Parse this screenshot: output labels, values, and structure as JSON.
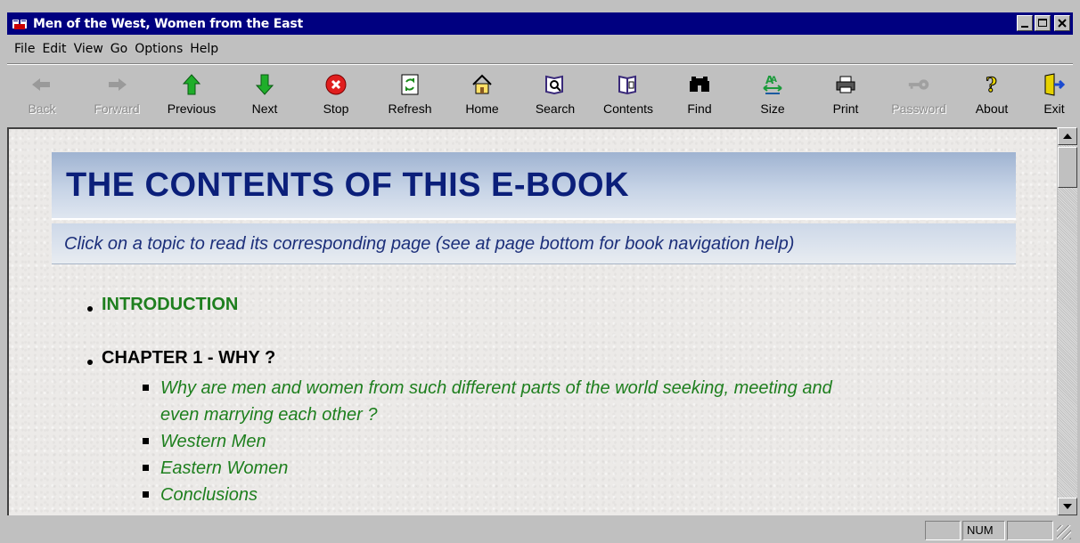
{
  "window": {
    "title": "Men of the West, Women from the East"
  },
  "menu": [
    {
      "label": "File"
    },
    {
      "label": "Edit"
    },
    {
      "label": "View"
    },
    {
      "label": "Go"
    },
    {
      "label": "Options"
    },
    {
      "label": "Help"
    }
  ],
  "toolbar": [
    {
      "label": "Back",
      "icon": "back-arrow-icon",
      "enabled": false
    },
    {
      "label": "Forward",
      "icon": "forward-arrow-icon",
      "enabled": false
    },
    {
      "label": "Previous",
      "icon": "up-arrow-icon",
      "enabled": true
    },
    {
      "label": "Next",
      "icon": "down-arrow-icon",
      "enabled": true
    },
    {
      "label": "Stop",
      "icon": "stop-icon",
      "enabled": true
    },
    {
      "label": "Refresh",
      "icon": "refresh-icon",
      "enabled": true
    },
    {
      "label": "Home",
      "icon": "home-icon",
      "enabled": true
    },
    {
      "label": "Search",
      "icon": "search-icon",
      "enabled": true
    },
    {
      "label": "Contents",
      "icon": "contents-icon",
      "enabled": true
    },
    {
      "label": "Find",
      "icon": "binoculars-icon",
      "enabled": true
    },
    {
      "label": "Size",
      "icon": "font-size-icon",
      "enabled": true
    },
    {
      "label": "Print",
      "icon": "printer-icon",
      "enabled": true
    },
    {
      "label": "Password",
      "icon": "key-icon",
      "enabled": false
    },
    {
      "label": "About",
      "icon": "question-icon",
      "enabled": true
    },
    {
      "label": "Exit",
      "icon": "exit-door-icon",
      "enabled": true
    }
  ],
  "page": {
    "heading": "THE CONTENTS OF THIS E-BOOK",
    "subheading": "Click on a topic to read its corresponding page (see at page bottom for book navigation help)",
    "toc": {
      "introduction": "INTRODUCTION",
      "chapter1": "CHAPTER 1 - WHY ?",
      "chapter1_items": [
        "Why are men and women from such different parts of the world seeking, meeting and",
        "even marrying each other ?",
        "Western Men",
        "Eastern Women",
        "Conclusions"
      ]
    }
  },
  "status": {
    "num": "NUM"
  },
  "colors": {
    "titlebar": "#000080",
    "link": "#1e7f1e",
    "heading": "#0b1f7a"
  }
}
